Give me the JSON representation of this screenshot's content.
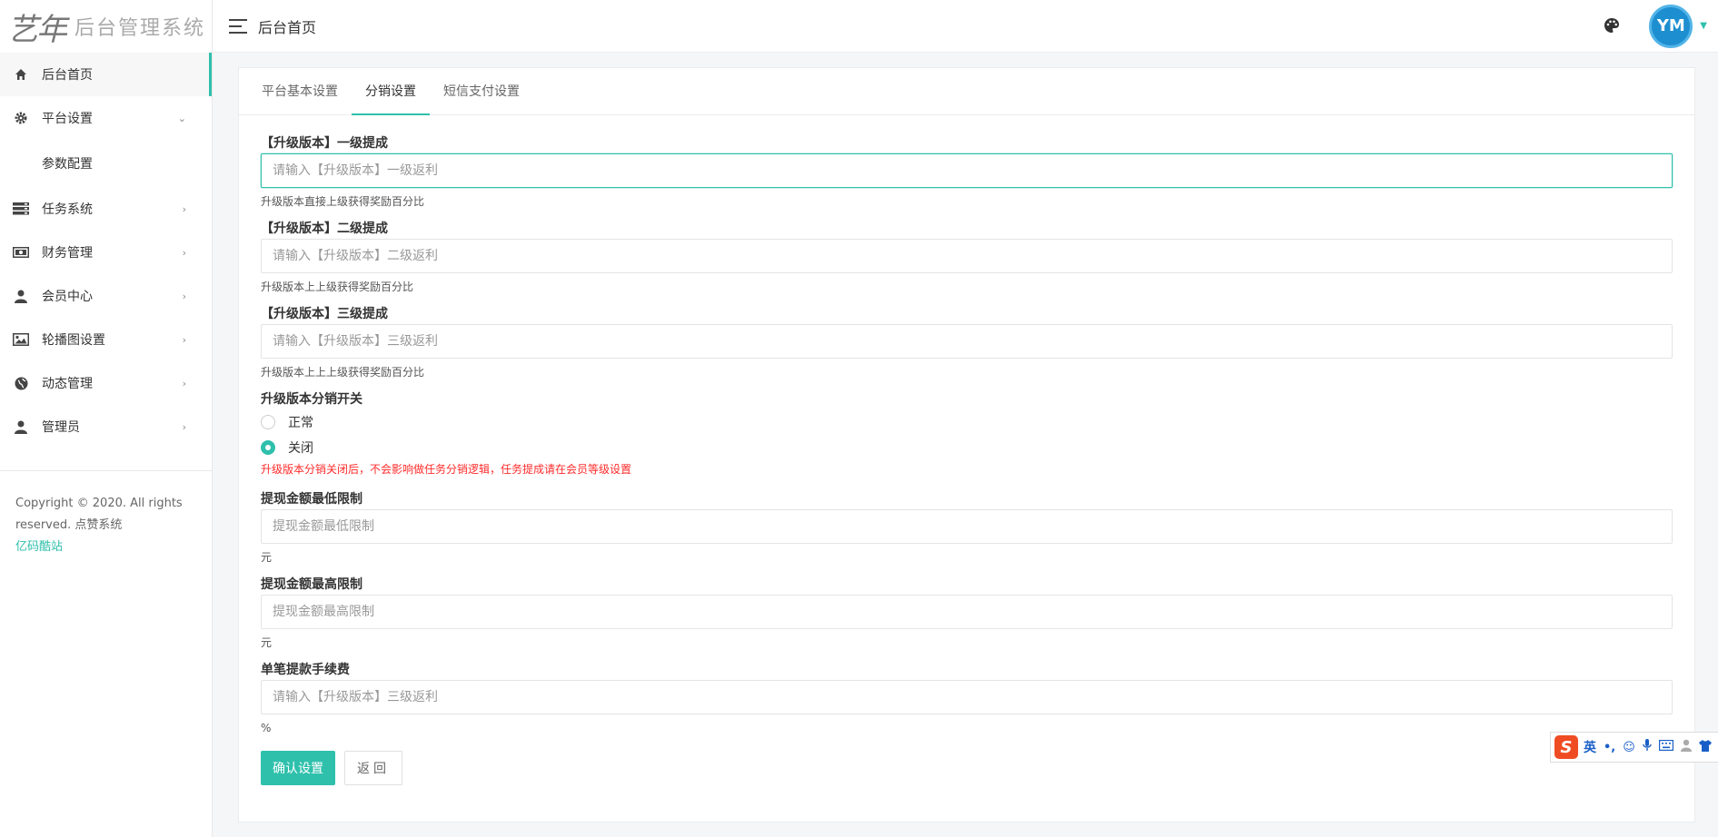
{
  "sidebar": {
    "logo_mark": "艺年",
    "logo_text": "后台管理系统",
    "items": [
      {
        "label": "后台首页",
        "icon": "home-icon"
      },
      {
        "label": "平台设置",
        "icon": "gear-icon",
        "expanded": true
      },
      {
        "label": "参数配置"
      },
      {
        "label": "任务系统",
        "icon": "server-icon"
      },
      {
        "label": "财务管理",
        "icon": "money-icon"
      },
      {
        "label": "会员中心",
        "icon": "user-icon"
      },
      {
        "label": "轮播图设置",
        "icon": "image-icon"
      },
      {
        "label": "动态管理",
        "icon": "globe-icon"
      },
      {
        "label": "管理员",
        "icon": "user-icon"
      }
    ],
    "copyright_line1": "Copyright © 2020. All rights",
    "copyright_line2": "reserved. 点赞系统",
    "copyright_link": "亿码酷站"
  },
  "topbar": {
    "title": "后台首页",
    "avatar_text": "YM"
  },
  "tabs": [
    {
      "label": "平台基本设置"
    },
    {
      "label": "分销设置",
      "active": true
    },
    {
      "label": "短信支付设置"
    }
  ],
  "form": {
    "level1": {
      "label": "【升级版本】一级提成",
      "placeholder": "请输入【升级版本】一级返利",
      "hint": "升级版本直接上级获得奖励百分比"
    },
    "level2": {
      "label": "【升级版本】二级提成",
      "placeholder": "请输入【升级版本】二级返利",
      "hint": "升级版本上上级获得奖励百分比"
    },
    "level3": {
      "label": "【升级版本】三级提成",
      "placeholder": "请输入【升级版本】三级返利",
      "hint": "升级版本上上上级获得奖励百分比"
    },
    "switch": {
      "label": "升级版本分销开关",
      "option_normal": "正常",
      "option_closed": "关闭",
      "selected": "关闭",
      "warning": "升级版本分销关闭后，不会影响做任务分销逻辑，任务提成请在会员等级设置"
    },
    "withdraw_min": {
      "label": "提现金额最低限制",
      "placeholder": "提现金额最低限制",
      "unit": "元"
    },
    "withdraw_max": {
      "label": "提现金额最高限制",
      "placeholder": "提现金额最高限制",
      "unit": "元"
    },
    "fee": {
      "label": "单笔提款手续费",
      "placeholder": "请输入【升级版本】三级返利",
      "unit": "%"
    },
    "submit_label": "确认设置",
    "back_label": "返回"
  },
  "ime": {
    "logo": "S",
    "lang": "英",
    "punct": "•,"
  },
  "colors": {
    "accent": "#2fc0ac",
    "warning": "#ff2b2b"
  }
}
